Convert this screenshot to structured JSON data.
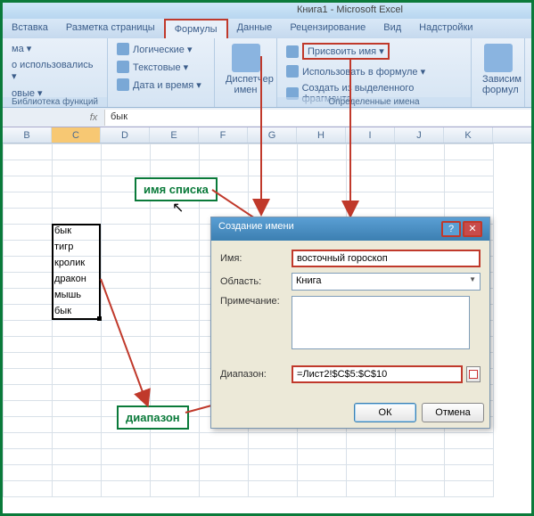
{
  "titlebar": "Книга1 - Microsoft Excel",
  "tabs": {
    "t0": "Вставка",
    "t1": "Разметка страницы",
    "t2": "Формулы",
    "t3": "Данные",
    "t4": "Рецензирование",
    "t5": "Вид",
    "t6": "Надстройки"
  },
  "ribbon": {
    "ma": "ма ▾",
    "used": "о использовались ▾",
    "financial": "овые ▾",
    "logical": "Логические ▾",
    "text": "Текстовые ▾",
    "datetime": "Дата и время ▾",
    "group1_label": "Библиотека функций",
    "name_mgr": "Диспетчер имен",
    "assign_name": "Присвоить имя ▾",
    "use_formula": "Использовать в формуле ▾",
    "create_sel": "Создать из выделенного фрагмента",
    "group2_label": "Определенные имена",
    "dependents": "Зависим формул"
  },
  "formula_bar": {
    "fx": "fx",
    "value": "бык"
  },
  "columns": [
    "B",
    "C",
    "D",
    "E",
    "F",
    "G",
    "H",
    "I",
    "J",
    "K"
  ],
  "cells": {
    "r5": "бык",
    "r6": "тигр",
    "r7": "кролик",
    "r8": "дракон",
    "r9": "мышь",
    "r10": "бык"
  },
  "labels": {
    "listname": "имя списка",
    "range": "диапазон"
  },
  "dialog": {
    "title": "Создание имени",
    "name_lbl": "Имя:",
    "name_val": "восточный гороскоп",
    "scope_lbl": "Область:",
    "scope_val": "Книга",
    "comment_lbl": "Примечание:",
    "range_lbl": "Диапазон:",
    "range_val": "=Лист2!$C$5:$C$10",
    "ok": "ОК",
    "cancel": "Отмена"
  }
}
